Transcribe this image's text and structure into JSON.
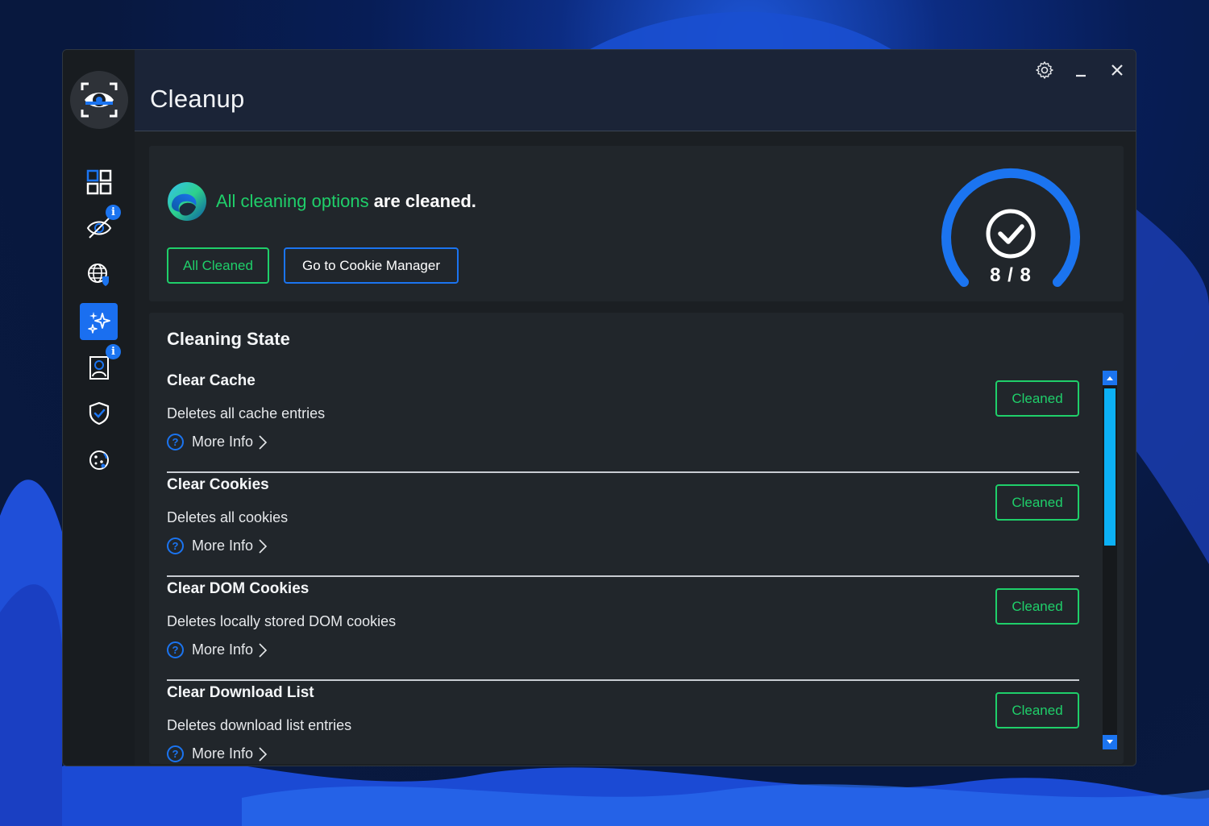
{
  "window": {
    "title": "Cleanup",
    "controls": [
      "settings-icon",
      "minimize-icon",
      "close-icon"
    ]
  },
  "sidebar": {
    "items": [
      {
        "name": "dashboard",
        "icon": "grid-icon",
        "active": false,
        "badge": ""
      },
      {
        "name": "tracking",
        "icon": "eye-slash-icon",
        "active": false,
        "badge": "i"
      },
      {
        "name": "web-protection",
        "icon": "globe-shield-icon",
        "active": false,
        "badge": ""
      },
      {
        "name": "cleanup",
        "icon": "sparkles-icon",
        "active": true,
        "badge": ""
      },
      {
        "name": "report",
        "icon": "document-person-icon",
        "active": false,
        "badge": "i"
      },
      {
        "name": "security",
        "icon": "shield-check-icon",
        "active": false,
        "badge": ""
      },
      {
        "name": "cookies",
        "icon": "cookie-icon",
        "active": false,
        "badge": ""
      }
    ]
  },
  "status": {
    "browser_icon": "edge-browser-icon",
    "highlight": "All cleaning options",
    "message": " are cleaned.",
    "all_cleaned_label": "All Cleaned",
    "cookie_manager_label": "Go to Cookie Manager",
    "cleaned_count": 8,
    "total_count": 8,
    "count_label": "8 / 8"
  },
  "cleaning_state": {
    "title": "Cleaning State",
    "more_info_label": "More Info",
    "items": [
      {
        "title": "Clear Cache",
        "description": "Deletes all cache entries",
        "status": "Cleaned"
      },
      {
        "title": "Clear Cookies",
        "description": "Deletes all cookies",
        "status": "Cleaned"
      },
      {
        "title": "Clear DOM Cookies",
        "description": "Deletes locally stored DOM cookies",
        "status": "Cleaned"
      },
      {
        "title": "Clear Download List",
        "description": "Deletes download list entries",
        "status": "Cleaned"
      }
    ]
  },
  "colors": {
    "accent_blue": "#1b74f0",
    "success_green": "#1fcf6a",
    "scroll_thumb": "#0cb1f6"
  }
}
